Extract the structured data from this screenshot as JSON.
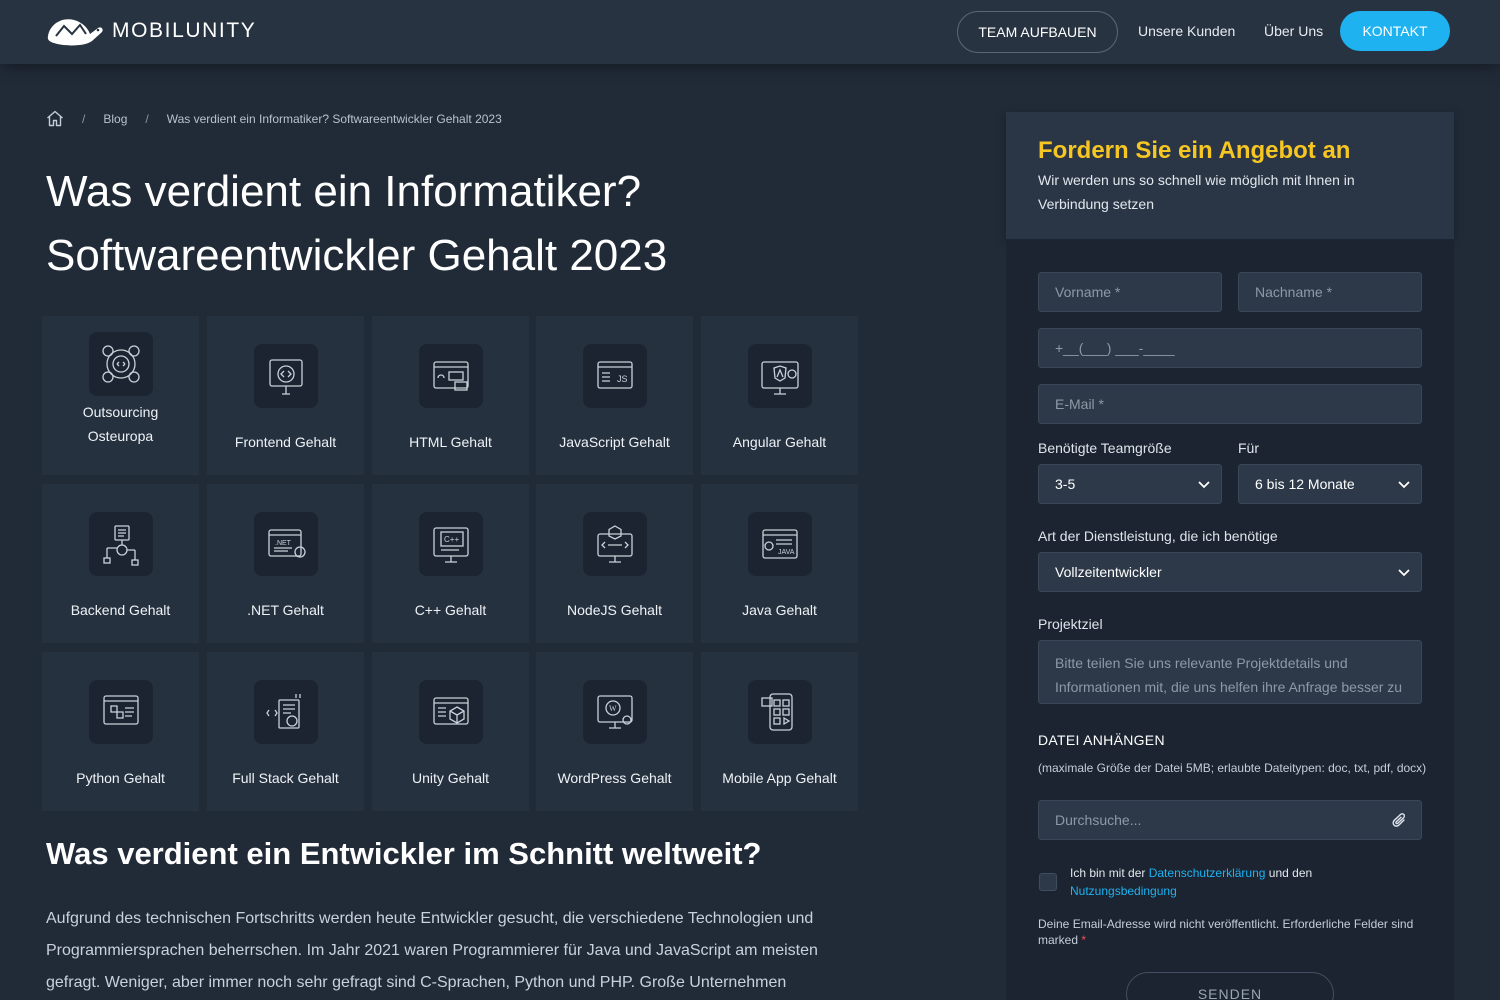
{
  "header": {
    "logo_text": "MOBILUNITY",
    "nav": {
      "team": "TEAM AUFBAUEN",
      "kunden": "Unsere Kunden",
      "ueber": "Über Uns",
      "kontakt": "KONTAKT"
    }
  },
  "breadcrumb": {
    "blog": "Blog",
    "current": "Was verdient ein Informatiker? Softwareentwickler Gehalt 2023"
  },
  "title": {
    "line1": "Was verdient ein Informatiker?",
    "line2": "Softwareentwickler Gehalt 2023"
  },
  "tiles": [
    {
      "line1": "Outsourcing",
      "line2": "Osteuropa",
      "icon": "outsourcing-icon"
    },
    {
      "line1": "Frontend Gehalt",
      "icon": "frontend-icon"
    },
    {
      "line1": "HTML Gehalt",
      "icon": "html-icon"
    },
    {
      "line1": "JavaScript Gehalt",
      "icon": "javascript-icon"
    },
    {
      "line1": "Angular Gehalt",
      "icon": "angular-icon"
    },
    {
      "line1": "Backend Gehalt",
      "icon": "backend-icon"
    },
    {
      "line1": ".NET Gehalt",
      "icon": "dotnet-icon"
    },
    {
      "line1": "C++ Gehalt",
      "icon": "cpp-icon"
    },
    {
      "line1": "NodeJS Gehalt",
      "icon": "nodejs-icon"
    },
    {
      "line1": "Java Gehalt",
      "icon": "java-icon"
    },
    {
      "line1": "Python Gehalt",
      "icon": "python-icon"
    },
    {
      "line1": "Full Stack Gehalt",
      "icon": "fullstack-icon"
    },
    {
      "line1": "Unity Gehalt",
      "icon": "unity-icon"
    },
    {
      "line1": "WordPress Gehalt",
      "icon": "wordpress-icon"
    },
    {
      "line1": "Mobile App Gehalt",
      "icon": "mobile-app-icon"
    }
  ],
  "section": {
    "heading": "Was verdient ein Entwickler im Schnitt weltweit?",
    "paragraph": "Aufgrund des technischen Fortschritts werden heute Entwickler gesucht, die verschiedene Technologien und Programmiersprachen beherrschen. Im Jahr 2021 waren Programmierer für Java und JavaScript am meisten gefragt. Weniger, aber immer noch sehr gefragt sind C-Sprachen, Python und PHP. Große Unternehmen neigen"
  },
  "form": {
    "title": "Fordern Sie ein Angebot an",
    "subtitle": "Wir werden uns so schnell wie möglich mit Ihnen in Verbindung setzen",
    "vorname_placeholder": "Vorname *",
    "nachname_placeholder": "Nachname *",
    "phone_placeholder": "+__(___) ___-____",
    "email_placeholder": "E-Mail *",
    "team_label": "Benötigte Teamgröße",
    "team_value": "3-5",
    "fuer_label": "Für",
    "fuer_value": "6 bis 12 Monate",
    "service_label": "Art der Dienstleistung, die ich benötige",
    "service_value": "Vollzeitentwickler",
    "ziel_label": "Projektziel",
    "ziel_placeholder": "Bitte teilen Sie uns relevante Projektdetails und Informationen mit, die uns helfen ihre Anfrage besser zu verstehen und zu beantworten",
    "attach_title": "DATEI ANHÄNGEN",
    "attach_note": "(maximale Größe der Datei 5MB; erlaubte Dateitypen: doc, txt, pdf, docx)",
    "browse_placeholder": "Durchsuche...",
    "consent_prefix": "Ich bin mit der",
    "consent_link1": "Datenschutzerklärung",
    "consent_mid": "und den",
    "consent_link2": "Nutzungsbedingung",
    "note_text": "Deine Email-Adresse wird nicht veröffentlicht. Erforderliche Felder sind marked",
    "note_star": "*",
    "send": "SENDEN"
  },
  "colors": {
    "accent": "#1fb2f1",
    "heading_yellow": "#f6c623",
    "background": "#212b38"
  }
}
